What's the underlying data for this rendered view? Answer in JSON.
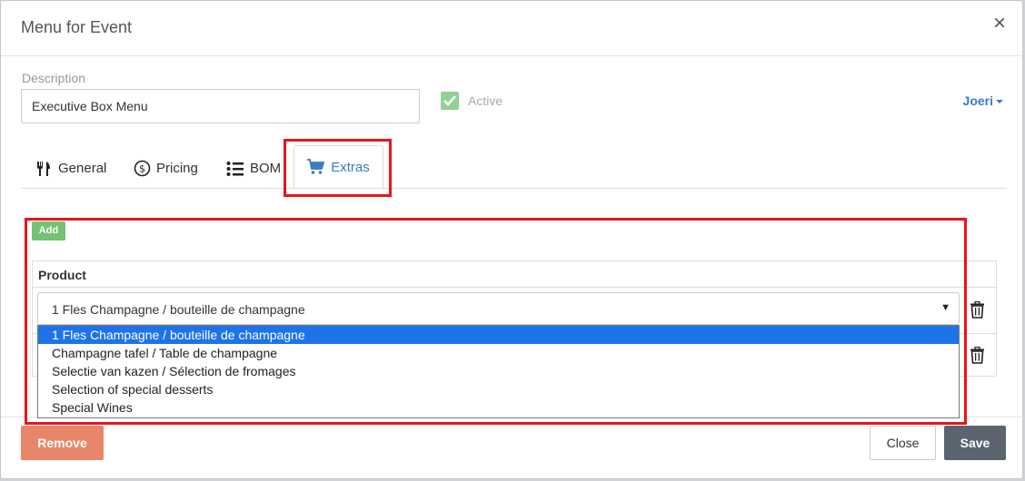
{
  "modal": {
    "title": "Menu for Event",
    "close_glyph": "×"
  },
  "description": {
    "label": "Description",
    "value": "Executive Box Menu"
  },
  "active": {
    "label": "Active",
    "checked": true
  },
  "user": {
    "name": "Joeri"
  },
  "tabs": [
    {
      "label": "General",
      "icon": "cutlery-icon"
    },
    {
      "label": "Pricing",
      "icon": "dollar-circle-icon"
    },
    {
      "label": "BOM",
      "icon": "list-icon"
    },
    {
      "label": "Extras",
      "icon": "cart-icon",
      "active": true
    }
  ],
  "extras": {
    "add_label": "Add",
    "table_header": "Product",
    "selected_value": "1 Fles Champagne / bouteille de champagne",
    "options": [
      "1 Fles Champagne / bouteille de champagne",
      "Champagne tafel / Table de champagne",
      "Selectie van kazen / Sélection de fromages",
      "Selection of special desserts",
      "Special Wines"
    ]
  },
  "footer": {
    "remove_label": "Remove",
    "close_label": "Close",
    "save_label": "Save"
  },
  "colors": {
    "link": "#3a7cc5",
    "highlight": "#e8141b",
    "success": "#5cb85c",
    "danger": "#e8866a",
    "primary_dark": "#5a6570",
    "option_selected": "#1e73e8"
  }
}
